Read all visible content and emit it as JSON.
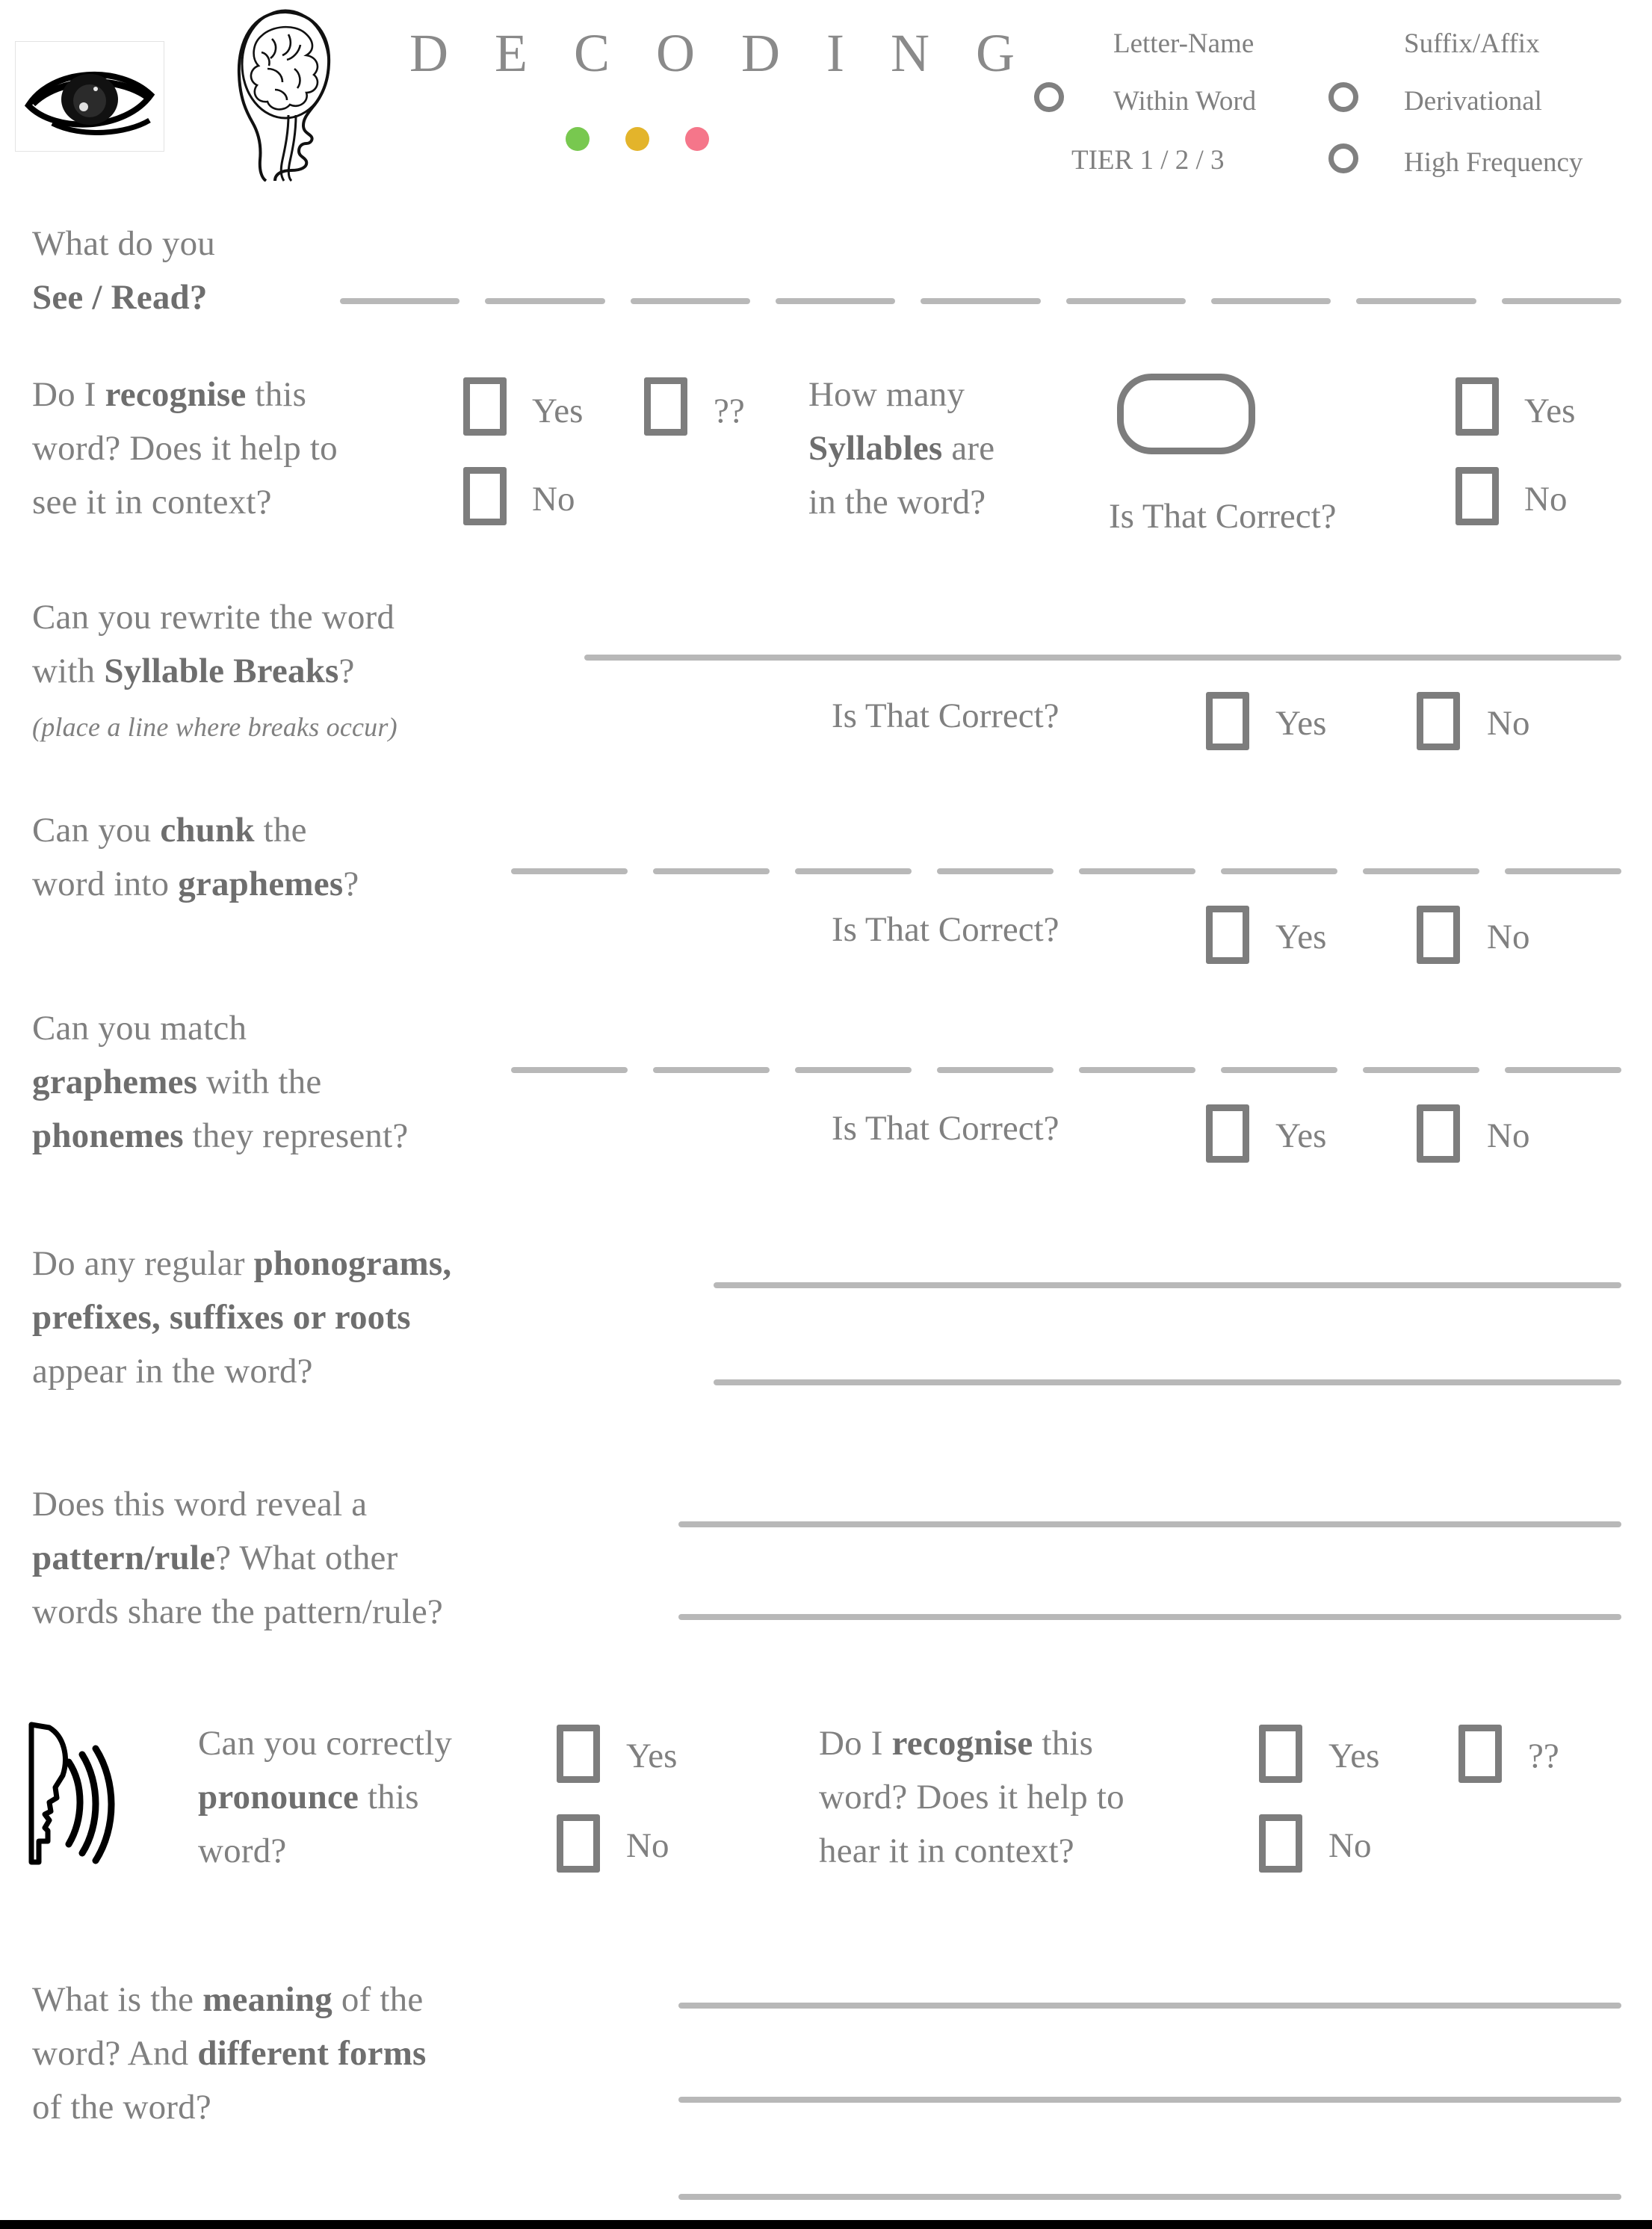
{
  "header": {
    "title": "D E C O D I N G",
    "eye_icon": "eye-icon",
    "brain_icon": "brain-head-icon",
    "dots": [
      {
        "name": "green-dot",
        "color": "#78c84f"
      },
      {
        "name": "yellow-dot",
        "color": "#e3b42b"
      },
      {
        "name": "pink-dot",
        "color": "#f5768a"
      }
    ],
    "stage_labels": {
      "letter_name": "Letter-Name",
      "within_word": "Within Word",
      "tier": "TIER 1 / 2 / 3",
      "suffix_affix": "Suffix/Affix",
      "derivational": "Derivational",
      "high_frequency": "High Frequency"
    }
  },
  "see_read": {
    "line1": "What do you",
    "line2": "See / Read?",
    "blank_segments": 9
  },
  "row_recognise_see": {
    "prompt_line1_a": "Do I ",
    "prompt_line1_b": "recognise",
    "prompt_line1_c": " this",
    "prompt_line2": "word? Does it help to",
    "prompt_line3": "see it in context?",
    "yes": "Yes",
    "no": "No",
    "unsure": "??"
  },
  "row_syllables": {
    "prompt_line1": "How many",
    "prompt_line2_a": "Syllables",
    "prompt_line2_b": " are",
    "prompt_line3": "in the word?",
    "is_that_correct": "Is That Correct?",
    "yes": "Yes",
    "no": "No"
  },
  "row_syllable_breaks": {
    "line1": "Can you rewrite the word",
    "line2_a": "with ",
    "line2_b": "Syllable Breaks",
    "line2_c": "?",
    "line3_italic": "(place a line where breaks occur)",
    "is_that_correct": "Is That Correct?",
    "yes": "Yes",
    "no": "No"
  },
  "row_chunk": {
    "line1_a": "Can you ",
    "line1_b": "chunk",
    "line1_c": " the",
    "line2_a": "word into ",
    "line2_b": "graphemes",
    "line2_c": "?",
    "blank_segments": 8,
    "is_that_correct": "Is That Correct?",
    "yes": "Yes",
    "no": "No"
  },
  "row_match": {
    "line1": "Can you match",
    "line2_a": "graphemes",
    "line2_b": " with the",
    "line3_a": "phonemes",
    "line3_b": " they represent?",
    "blank_segments": 8,
    "is_that_correct": "Is That Correct?",
    "yes": "Yes",
    "no": "No"
  },
  "row_phonograms": {
    "line1_a": "Do any regular ",
    "line1_b": "phonograms,",
    "line2_b": "prefixes, suffixes or roots",
    "line3": "appear in the word?"
  },
  "row_pattern": {
    "line1": "Does this word reveal a",
    "line2_a": "pattern/rule",
    "line2_b": "? What other",
    "line3": "words share the pattern/rule?"
  },
  "row_pronounce": {
    "speak_icon": "speaking-head-icon",
    "line1": "Can you correctly",
    "line2_a": "pronounce",
    "line2_b": " this",
    "line3": "word?",
    "yes": "Yes",
    "no": "No"
  },
  "row_recognise_hear": {
    "line1_a": "Do I ",
    "line1_b": "recognise",
    "line1_c": " this",
    "line2": "word? Does it help to",
    "line3": "hear it in context?",
    "yes": "Yes",
    "no": "No",
    "unsure": "??"
  },
  "row_meaning": {
    "line1_a": "What is the ",
    "line1_b": "meaning",
    "line1_c": " of the",
    "line2_a": "word? And ",
    "line2_b": "different forms",
    "line3": "of the word?"
  },
  "colors": {
    "text": "#808080",
    "rule": "#b8b8b8",
    "box_border": "#7d7d7d"
  }
}
